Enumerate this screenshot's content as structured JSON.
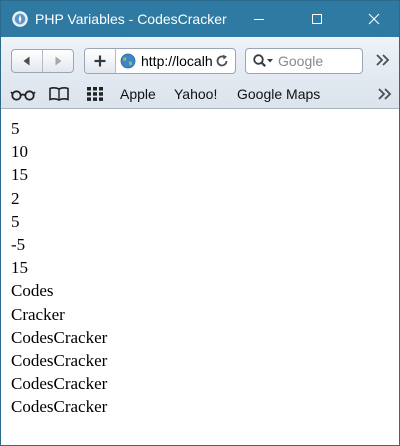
{
  "window": {
    "title": "PHP Variables - CodesCracker"
  },
  "toolbar": {
    "url": "http://localhost",
    "search_placeholder": "Google"
  },
  "bookmarks": {
    "items": [
      {
        "label": "Apple"
      },
      {
        "label": "Yahoo!"
      },
      {
        "label": "Google Maps"
      }
    ]
  },
  "content": {
    "lines": [
      "5",
      "10",
      "15",
      "2",
      "5",
      "-5",
      "15",
      "Codes",
      "Cracker",
      "CodesCracker",
      "CodesCracker",
      "CodesCracker",
      "CodesCracker"
    ]
  },
  "colors": {
    "titlebar": "#2e7aa3",
    "toolbar": "#eef3f8"
  }
}
